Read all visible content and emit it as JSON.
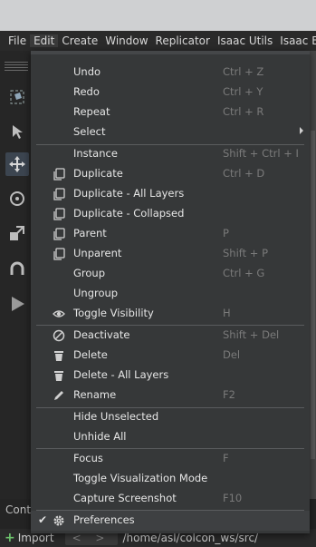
{
  "menubar": {
    "items": [
      "File",
      "Edit",
      "Create",
      "Window",
      "Replicator",
      "Isaac Utils",
      "Isaac Exam"
    ]
  },
  "contents_tab": "Cont",
  "path_bar": {
    "import_label": "Import",
    "nav": "< >",
    "path": "/home/asl/colcon_ws/src/"
  },
  "edit_menu": {
    "undo": {
      "label": "Undo",
      "shortcut": "Ctrl + Z"
    },
    "redo": {
      "label": "Redo",
      "shortcut": "Ctrl + Y"
    },
    "repeat": {
      "label": "Repeat",
      "shortcut": "Ctrl + R"
    },
    "select": {
      "label": "Select"
    },
    "instance": {
      "label": "Instance",
      "shortcut": "Shift + Ctrl + I"
    },
    "duplicate": {
      "label": "Duplicate",
      "shortcut": "Ctrl + D"
    },
    "duplicate_all_layers": {
      "label": "Duplicate - All Layers"
    },
    "duplicate_collapsed": {
      "label": "Duplicate - Collapsed"
    },
    "parent": {
      "label": "Parent",
      "shortcut": "P"
    },
    "unparent": {
      "label": "Unparent",
      "shortcut": "Shift + P"
    },
    "group": {
      "label": "Group",
      "shortcut": "Ctrl + G"
    },
    "ungroup": {
      "label": "Ungroup"
    },
    "toggle_visibility": {
      "label": "Toggle Visibility",
      "shortcut": "H"
    },
    "deactivate": {
      "label": "Deactivate",
      "shortcut": "Shift + Del"
    },
    "delete": {
      "label": "Delete",
      "shortcut": "Del"
    },
    "delete_all_layers": {
      "label": "Delete - All Layers"
    },
    "rename": {
      "label": "Rename",
      "shortcut": "F2"
    },
    "hide_unselected": {
      "label": "Hide Unselected"
    },
    "unhide_all": {
      "label": "Unhide All"
    },
    "focus": {
      "label": "Focus",
      "shortcut": "F"
    },
    "toggle_viz_mode": {
      "label": "Toggle Visualization Mode"
    },
    "capture_screenshot": {
      "label": "Capture Screenshot",
      "shortcut": "F10"
    },
    "preferences": {
      "label": "Preferences",
      "checked": true
    }
  },
  "icons": {
    "duplicate": "copy-icon",
    "toggle_visibility": "eye-icon",
    "deactivate": "disabled-circle-icon",
    "delete": "trash-icon",
    "rename": "pencil-icon",
    "preferences": "gear-icon"
  },
  "colors": {
    "menu_bg": "#363839",
    "menu_text": "#e6e6e6",
    "shortcut_text": "#7a7a7a",
    "separator": "#5a5c5e",
    "toolbar_selected": "#3c4550",
    "import_plus": "#6cc26c"
  }
}
